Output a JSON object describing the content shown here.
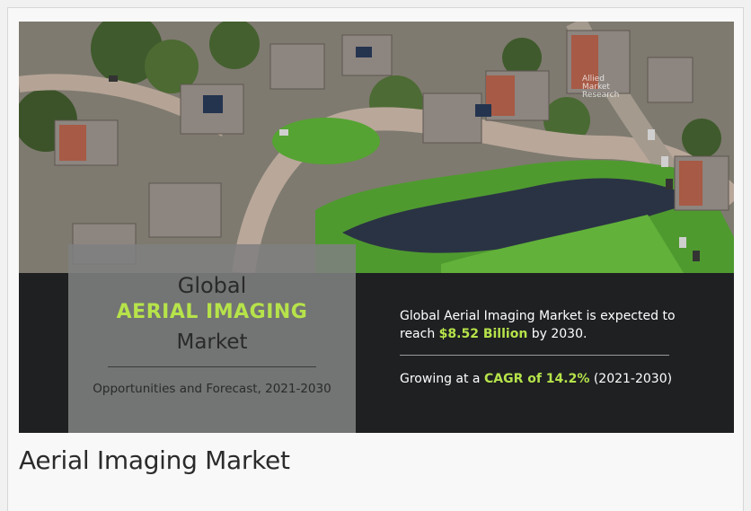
{
  "figure": {
    "photo_alt": "aerial-neighborhood-photo",
    "logo": {
      "line1": "Allied",
      "line2": "Market",
      "line3": "Research"
    },
    "title_card": {
      "line1": "Global",
      "line2": "AERIAL IMAGING",
      "line3": "Market",
      "subtitle": "Opportunities and Forecast, 2021-2030"
    },
    "stats": {
      "line1_prefix": "Global Aerial Imaging Market is expected to reach ",
      "line1_highlight": "$8.52 Billion",
      "line1_suffix": " by 2030.",
      "line2_prefix": "Growing at a ",
      "line2_highlight": "CAGR of 14.2%",
      "line2_suffix": " (2021-2030)"
    }
  },
  "caption": "Aerial Imaging Market",
  "colors": {
    "accent_green": "#b6e34a",
    "banner_bg": "#1e2022",
    "card_bg": "#808080"
  }
}
